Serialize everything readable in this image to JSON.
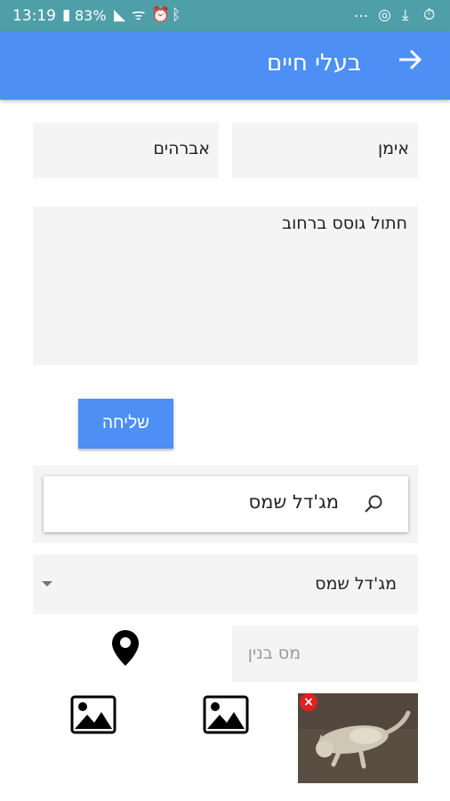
{
  "status_bar": {
    "time": "13:19",
    "battery": "83%",
    "more": "..."
  },
  "app_bar": {
    "title": "בעלי חיים",
    "back_icon": "arrow-right-icon"
  },
  "form": {
    "first_name": "אימן",
    "last_name": "אברהים",
    "description": "חתול גוסס ברחוב",
    "send_label": "שליחה"
  },
  "location": {
    "search_text": "מג'דל שמס",
    "dropdown_value": "מג'דל שמס",
    "building_placeholder": "מס בנין"
  },
  "colors": {
    "status_bar": "#4f9fa8",
    "app_bar": "#4d8ff5",
    "field_bg": "#f4f4f4",
    "remove_badge": "#e02020"
  }
}
